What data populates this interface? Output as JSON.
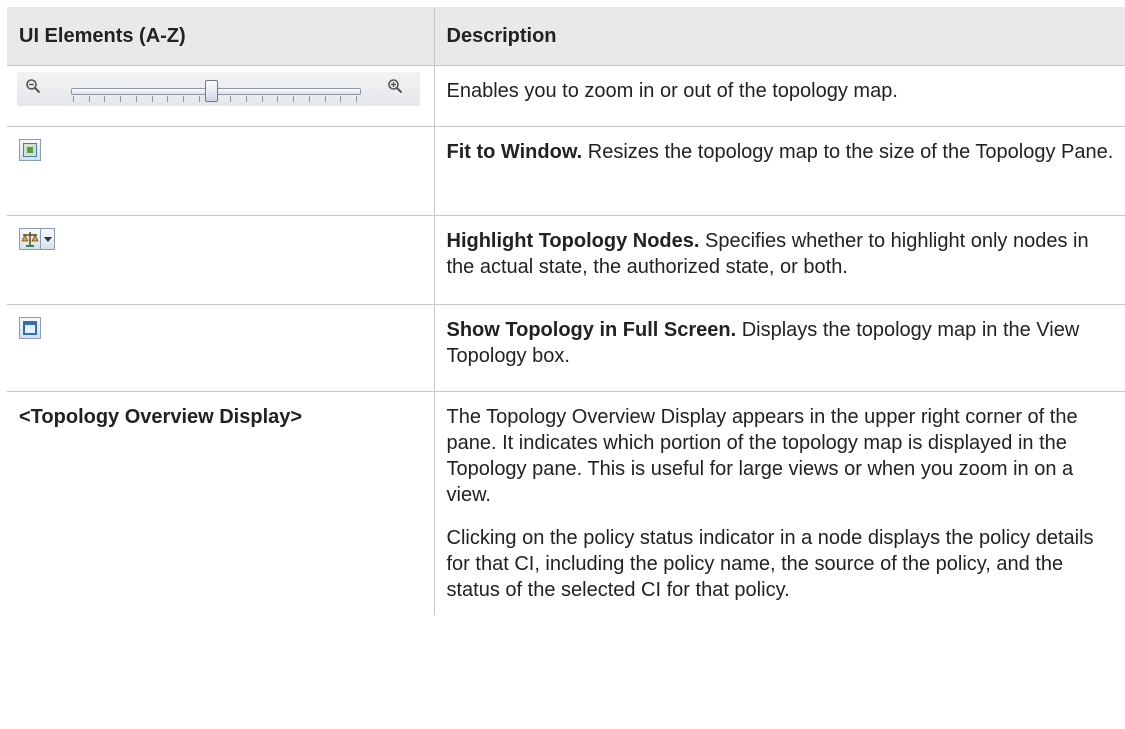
{
  "table": {
    "headers": [
      "UI Elements (A-Z)",
      "Description"
    ],
    "rows": [
      {
        "element": "",
        "element_icon": "zoom-slider-icon",
        "bold": "",
        "text": "Enables you to zoom in or out of the topology map."
      },
      {
        "element": "",
        "element_icon": "fit-to-window-icon",
        "bold": "Fit to Window.",
        "text": " Resizes the topology map to the size of the Topology Pane."
      },
      {
        "element": "",
        "element_icon": "highlight-nodes-icon",
        "bold": "Highlight Topology Nodes.",
        "text": " Specifies whether to highlight only nodes in the actual state, the authorized state, or both."
      },
      {
        "element": "",
        "element_icon": "full-screen-icon",
        "bold": "Show Topology in Full Screen.",
        "text": " Displays the topology map in the View Topology box."
      },
      {
        "element": "<Topology Overview Display>",
        "element_icon": "",
        "bold": "",
        "text": "The Topology Overview Display appears in the upper right corner of the pane. It indicates which portion of the topology map is displayed in the Topology pane. This is useful for large views or when you zoom in on a view.",
        "text2": "Clicking on the policy status indicator in a node displays the policy details for that CI, including the policy name, the source of the policy, and the status of the selected CI for that policy."
      }
    ]
  },
  "colors": {
    "header_bg": "#e9e9e9",
    "border": "#c8c8c8",
    "text": "#222222"
  }
}
